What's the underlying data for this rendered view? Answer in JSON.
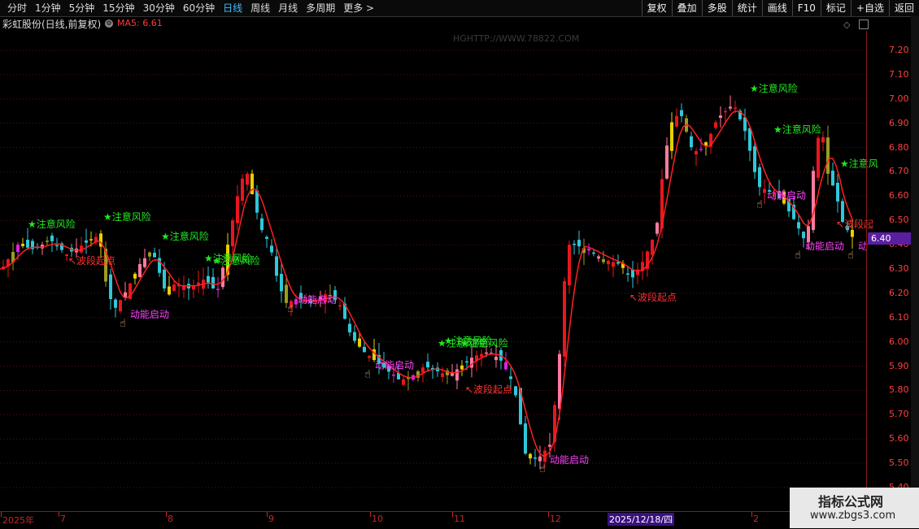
{
  "toolbar": {
    "periods": [
      "分时",
      "1分钟",
      "5分钟",
      "15分钟",
      "30分钟",
      "60分钟",
      "日线",
      "周线",
      "月线",
      "多周期",
      "更多 >"
    ],
    "active": "日线",
    "right_buttons": [
      "复权",
      "叠加",
      "多股",
      "统计",
      "画线",
      "F10",
      "标记",
      "+自选",
      "返回"
    ]
  },
  "header": {
    "stock_title": "彩虹股份(日线,前复权)",
    "ma_label": "MA5: 6.61",
    "watermark": "HGHTTP://WWW.78822.COM"
  },
  "price_tag": "6.40",
  "logo": {
    "line1": "指标公式网",
    "line2": "www.zbgs3.com"
  },
  "colors": {
    "up": "#e8161e",
    "up_pink": "#ff7aa0",
    "down": "#2ec8d8",
    "yellow": "#e6d000",
    "olive": "#9c9c20",
    "magenta": "#e020e0",
    "ma": "#ff2020",
    "green_text": "#22e822",
    "pink_text": "#ff40ff"
  },
  "chart_data": {
    "type": "candlestick",
    "yticks": [
      "7.20",
      "7.10",
      "7.00",
      "6.90",
      "6.80",
      "6.70",
      "6.60",
      "6.50",
      "6.40",
      "6.30",
      "6.20",
      "6.10",
      "6.00",
      "5.90",
      "5.80",
      "5.70",
      "5.60",
      "5.50",
      "5.40"
    ],
    "ylim": [
      5.4,
      7.2
    ],
    "xlabels": [
      "2025年",
      "7",
      "8",
      "9",
      "10",
      "11",
      "12",
      "1",
      "2"
    ],
    "cursor_date": "2025/12/18/四",
    "ma_line": {
      "name": "MA5",
      "last_value": 6.61
    },
    "annotations": [
      {
        "text": "★注意风险",
        "type": "risk",
        "x": 34,
        "y": 6.47
      },
      {
        "text": "★注意风险",
        "type": "risk",
        "x": 127,
        "y": 6.5
      },
      {
        "text": "★注意风险",
        "type": "risk",
        "x": 198,
        "y": 6.42
      },
      {
        "text": "★注意风险",
        "type": "risk",
        "x": 251,
        "y": 6.33
      },
      {
        "text": "★注意风险",
        "type": "risk",
        "x": 261,
        "y": 6.32
      },
      {
        "text": "★注意风险",
        "type": "risk",
        "x": 546,
        "y": 5.99
      },
      {
        "text": "★注意风险",
        "type": "risk",
        "x": 538,
        "y": 5.98
      },
      {
        "text": "★注意风险",
        "type": "risk",
        "x": 566,
        "y": 5.98
      },
      {
        "text": "★注意风险",
        "type": "risk",
        "x": 922,
        "y": 7.03
      },
      {
        "text": "★注意风险",
        "type": "risk",
        "x": 951,
        "y": 6.86
      },
      {
        "text": "★注意风",
        "type": "risk",
        "x": 1033,
        "y": 6.72
      },
      {
        "text": "↖波段起点",
        "type": "wave",
        "x": 84,
        "y": 6.32
      },
      {
        "text": "↖波段起点",
        "type": "wave",
        "x": 774,
        "y": 6.17
      },
      {
        "text": "↖波段起点",
        "type": "wave",
        "x": 572,
        "y": 5.79
      },
      {
        "text": "↖波段起",
        "type": "wave",
        "x": 1028,
        "y": 6.47
      },
      {
        "text": "动能启动",
        "type": "momentum",
        "x": 160,
        "y": 6.1
      },
      {
        "text": "动能启动",
        "type": "momentum",
        "x": 366,
        "y": 6.16
      },
      {
        "text": "动能启动",
        "type": "momentum",
        "x": 461,
        "y": 5.89
      },
      {
        "text": "动能启动",
        "type": "momentum",
        "x": 676,
        "y": 5.5
      },
      {
        "text": "动能启动",
        "type": "momentum",
        "x": 943,
        "y": 6.59
      },
      {
        "text": "动能启动",
        "type": "momentum",
        "x": 990,
        "y": 6.38
      },
      {
        "text": "动",
        "type": "momentum",
        "x": 1055,
        "y": 6.38
      }
    ]
  }
}
